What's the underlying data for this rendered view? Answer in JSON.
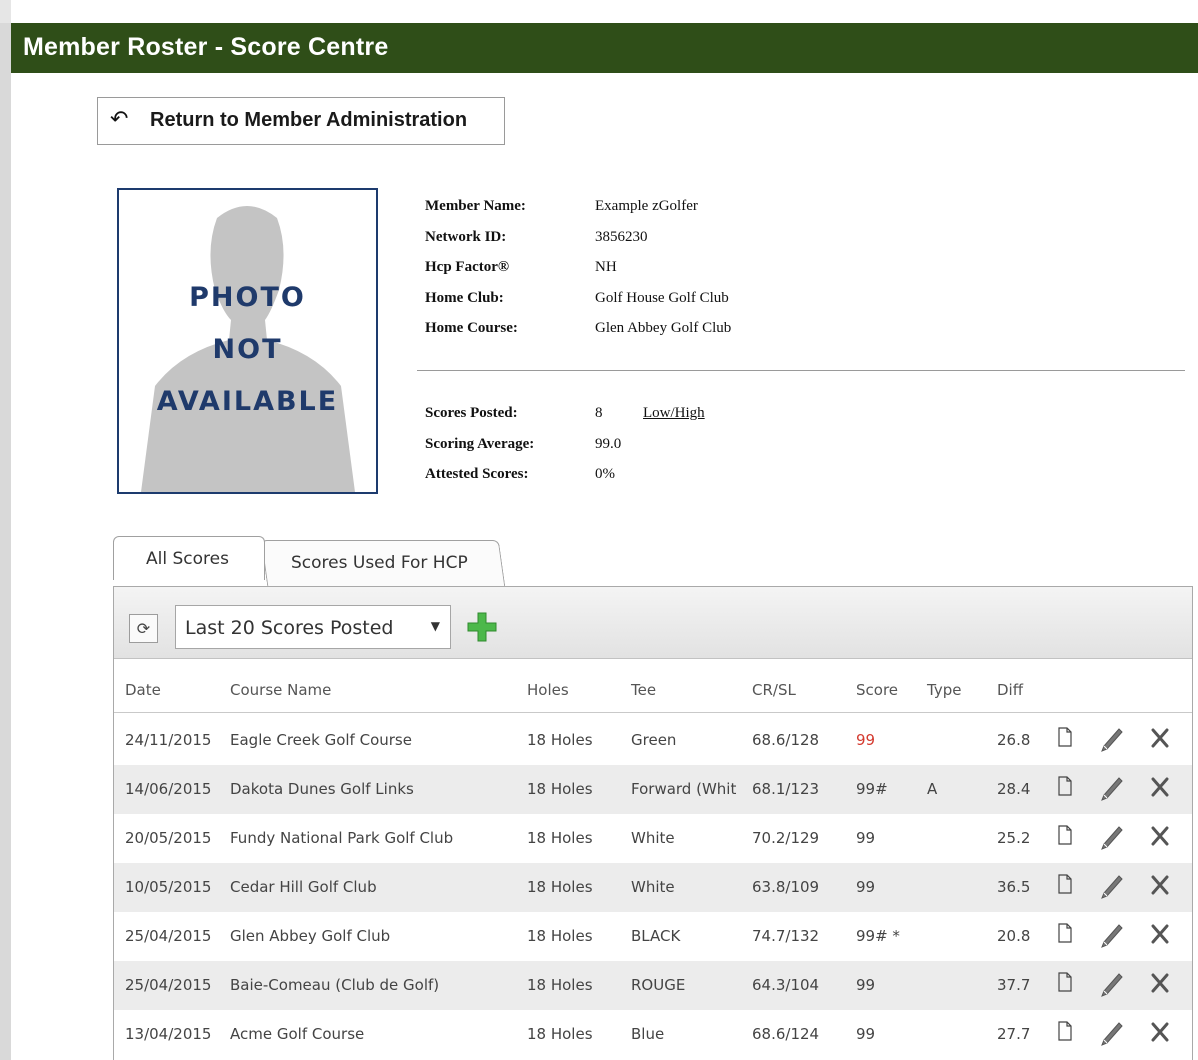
{
  "page": {
    "title": "Member Roster - Score Centre"
  },
  "return_button": {
    "label": "Return to Member Administration",
    "icon": "return-arrow-icon"
  },
  "photo": {
    "lines": [
      "PHOTO",
      "NOT",
      "AVAILABLE"
    ]
  },
  "member": {
    "fields": [
      {
        "label": "Member Name:",
        "value": "Example zGolfer"
      },
      {
        "label": "Network ID:",
        "value": "3856230"
      },
      {
        "label": "Hcp Factor®",
        "value": "NH"
      },
      {
        "label": "Home Club:",
        "value": "Golf House Golf Club"
      },
      {
        "label": "Home Course:",
        "value": "Glen Abbey Golf Club"
      }
    ]
  },
  "stats": {
    "fields": [
      {
        "label": "Scores Posted:",
        "value": "8"
      },
      {
        "label": "Scoring Average:",
        "value": "99.0"
      },
      {
        "label": "Attested Scores:",
        "value": "0%"
      }
    ],
    "low_high_link": "Low/High"
  },
  "tabs": [
    {
      "label": "All Scores",
      "active": true
    },
    {
      "label": "Scores Used For HCP",
      "active": false
    }
  ],
  "toolbar": {
    "refresh_icon": "refresh-icon",
    "filter_selected": "Last 20 Scores Posted",
    "add_icon": "add-plus-icon"
  },
  "table": {
    "columns": [
      "Date",
      "Course Name",
      "Holes",
      "Tee",
      "CR/SL",
      "Score",
      "Type",
      "Diff"
    ],
    "rows": [
      {
        "date": "24/11/2015",
        "course": "Eagle Creek Golf Course",
        "holes": "18 Holes",
        "tee": "Green",
        "crsl": "68.6/128",
        "score": "99",
        "score_color": "#d43a2f",
        "type": "",
        "diff": "26.8"
      },
      {
        "date": "14/06/2015",
        "course": "Dakota Dunes Golf Links",
        "holes": "18 Holes",
        "tee": "Forward (Whit",
        "crsl": "68.1/123",
        "score": "99#",
        "score_color": "#444444",
        "type": "A",
        "diff": "28.4"
      },
      {
        "date": "20/05/2015",
        "course": "Fundy National Park Golf Club",
        "holes": "18 Holes",
        "tee": "White",
        "crsl": "70.2/129",
        "score": "99",
        "score_color": "#444444",
        "type": "",
        "diff": "25.2"
      },
      {
        "date": "10/05/2015",
        "course": "Cedar Hill Golf Club",
        "holes": "18 Holes",
        "tee": "White",
        "crsl": "63.8/109",
        "score": "99",
        "score_color": "#444444",
        "type": "",
        "diff": "36.5"
      },
      {
        "date": "25/04/2015",
        "course": "Glen Abbey Golf Club",
        "holes": "18 Holes",
        "tee": "BLACK",
        "crsl": "74.7/132",
        "score": "99# *",
        "score_color": "#444444",
        "type": "",
        "diff": "20.8"
      },
      {
        "date": "25/04/2015",
        "course": "Baie-Comeau (Club de Golf)",
        "holes": "18 Holes",
        "tee": "ROUGE",
        "crsl": "64.3/104",
        "score": "99",
        "score_color": "#444444",
        "type": "",
        "diff": "37.7"
      },
      {
        "date": "13/04/2015",
        "course": "Acme Golf Course",
        "holes": "18 Holes",
        "tee": "Blue",
        "crsl": "68.6/124",
        "score": "99",
        "score_color": "#444444",
        "type": "",
        "diff": "27.7"
      }
    ],
    "row_actions": [
      "document-icon",
      "pencil-edit-icon",
      "delete-x-icon"
    ]
  },
  "colors": {
    "header_bg": "#2f4e18",
    "photo_border": "#1d3b6e",
    "add_green": "#4cb84a",
    "score_red": "#d43a2f"
  }
}
